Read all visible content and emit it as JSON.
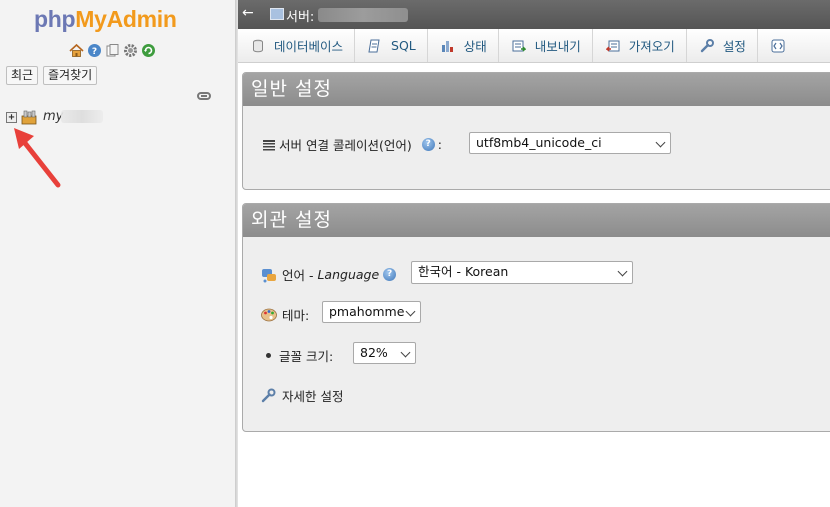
{
  "nav": {
    "logo_php": "php",
    "logo_myadmin": "MyAdmin",
    "recent_button": "최근",
    "favorites_button": "즐겨찾기",
    "db_name": "my",
    "icons": [
      "home-icon",
      "help-icon",
      "docs-icon",
      "settings-icon",
      "reload-icon"
    ]
  },
  "topbar": {
    "back": "←",
    "server_label": "서버:"
  },
  "tabs": [
    {
      "label": "데이터베이스",
      "icon": "database-icon"
    },
    {
      "label": "SQL",
      "icon": "sql-icon"
    },
    {
      "label": "상태",
      "icon": "status-icon"
    },
    {
      "label": "내보내기",
      "icon": "export-icon"
    },
    {
      "label": "가져오기",
      "icon": "import-icon"
    },
    {
      "label": "설정",
      "icon": "wrench-icon"
    },
    {
      "label": "",
      "icon": "more-icon"
    }
  ],
  "general": {
    "title": "일반 설정",
    "collation_label": "서버 연결 콜레이션(언어)",
    "collation_colon": ":",
    "collation_value": "utf8mb4_unicode_ci"
  },
  "appearance": {
    "title": "외관 설정",
    "language_label": "언어 - ",
    "language_italic": "Language",
    "language_value": "한국어 - Korean",
    "theme_label": "테마:",
    "theme_value": "pmahomme",
    "font_label": "글꼴 크기:",
    "font_value": "82%",
    "more_settings": "자세한 설정"
  },
  "colors": {
    "tab_text": "#235a81",
    "panel_header": "#999999",
    "topbar": "#606060",
    "logo_php": "#6c78b4",
    "logo_myadmin": "#f29a1c",
    "arrow": "#e8403a"
  }
}
